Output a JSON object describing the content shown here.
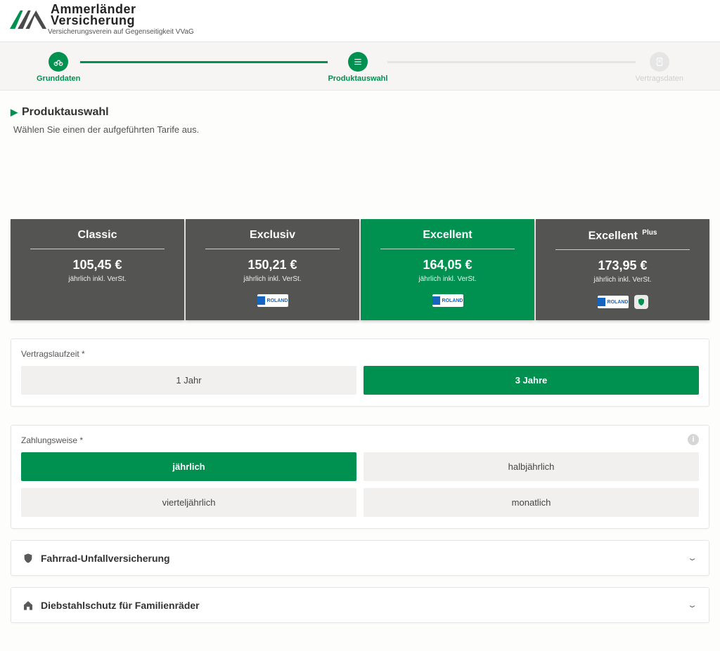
{
  "brand": {
    "name_line1": "Ammerländer",
    "name_line2": "Versicherung",
    "subline": "Versicherungsverein auf Gegenseitigkeit VVaG"
  },
  "progress": {
    "step1": "Grunddaten",
    "step2": "Produktauswahl",
    "step3": "Vertragsdaten"
  },
  "page": {
    "title": "Produktauswahl",
    "subtitle": "Wählen Sie einen der aufgeführten Tarife aus."
  },
  "tariffs": [
    {
      "name": "Classic",
      "sup": "",
      "price": "105,45 €",
      "note": "jährlich inkl. VerSt.",
      "selected": false,
      "roland": false,
      "shield": false
    },
    {
      "name": "Exclusiv",
      "sup": "",
      "price": "150,21 €",
      "note": "jährlich inkl. VerSt.",
      "selected": false,
      "roland": true,
      "shield": false
    },
    {
      "name": "Excellent",
      "sup": "",
      "price": "164,05 €",
      "note": "jährlich inkl. VerSt.",
      "selected": true,
      "roland": true,
      "shield": false
    },
    {
      "name": "Excellent",
      "sup": "Plus",
      "price": "173,95 €",
      "note": "jährlich inkl. VerSt.",
      "selected": false,
      "roland": true,
      "shield": true
    }
  ],
  "badges": {
    "roland_text": "ROLAND"
  },
  "contract_term": {
    "label": "Vertragslaufzeit *",
    "options": [
      {
        "label": "1 Jahr",
        "selected": false
      },
      {
        "label": "3 Jahre",
        "selected": true
      }
    ]
  },
  "payment": {
    "label": "Zahlungsweise *",
    "options": [
      {
        "label": "jährlich",
        "selected": true
      },
      {
        "label": "halbjährlich",
        "selected": false
      },
      {
        "label": "vierteljährlich",
        "selected": false
      },
      {
        "label": "monatlich",
        "selected": false
      }
    ]
  },
  "accordions": {
    "unfall": "Fahrrad-Unfallversicherung",
    "diebstahl": "Diebstahlschutz für Familienräder"
  }
}
